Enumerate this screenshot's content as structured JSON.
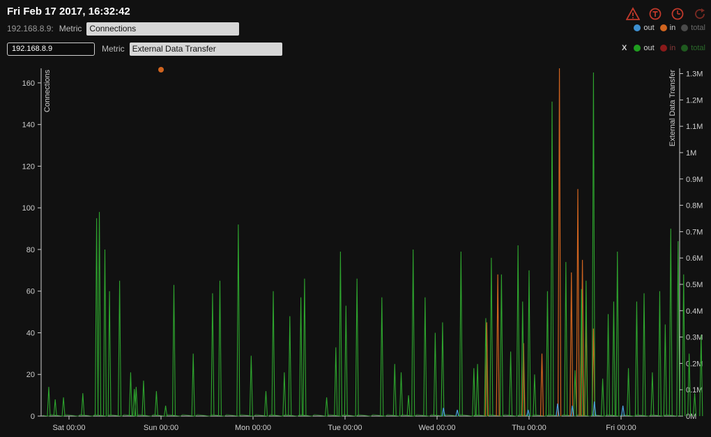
{
  "header": {
    "timestamp": "Fri Feb 17 2017, 16:32:42",
    "toolbar_icons": [
      "warning-icon",
      "cube-refresh-icon",
      "clock-icon",
      "reload-icon"
    ]
  },
  "metric1": {
    "ip_label": "192.168.8.9:",
    "metric_label": "Metric",
    "selected": "Connections"
  },
  "metric2": {
    "ip_value": "192.168.8.9",
    "metric_label": "Metric",
    "selected": "External Data Transfer"
  },
  "legend1": {
    "items": [
      {
        "label": "out",
        "color": "#3d8fd1"
      },
      {
        "label": "in",
        "color": "#d0641f"
      },
      {
        "label": "total",
        "color": "#4a4a4a"
      }
    ]
  },
  "legend2": {
    "close": "X",
    "items": [
      {
        "label": "out",
        "color": "#1f9e1f"
      },
      {
        "label": "in",
        "color": "#8a1a1a"
      },
      {
        "label": "total",
        "color": "#1f5a1f"
      }
    ]
  },
  "colors": {
    "background": "#111111",
    "out_green": "#2ea52e",
    "in_orange": "#d0641f",
    "conn_blue": "#4aa3e0"
  },
  "chart_data": {
    "type": "line",
    "ylabel": "Connections",
    "y2label": "External Data Transfer",
    "yticks": [
      0,
      20,
      40,
      60,
      80,
      100,
      120,
      140,
      160
    ],
    "y2ticks": [
      "0M",
      "0.1M",
      "0.2M",
      "0.3M",
      "0.4M",
      "0.5M",
      "0.6M",
      "0.7M",
      "0.8M",
      "0.9M",
      "1M",
      "1.1M",
      "1.2M",
      "1.3M"
    ],
    "xticks": [
      "Sat 00:00",
      "Sun 00:00",
      "Mon 00:00",
      "Tue 00:00",
      "Wed 00:00",
      "Thu 00:00",
      "Fri 00:00"
    ],
    "ylim": [
      0,
      167
    ],
    "y2lim": [
      0,
      1.32
    ],
    "marker": {
      "day": 1.0,
      "value": 167
    },
    "spikes_out": [
      [
        -0.22,
        14
      ],
      [
        -0.15,
        8
      ],
      [
        -0.06,
        9
      ],
      [
        0.15,
        11
      ],
      [
        0.3,
        95
      ],
      [
        0.33,
        98
      ],
      [
        0.39,
        80
      ],
      [
        0.44,
        60
      ],
      [
        0.55,
        65
      ],
      [
        0.67,
        21
      ],
      [
        0.71,
        13
      ],
      [
        0.73,
        14
      ],
      [
        0.81,
        17
      ],
      [
        0.95,
        12
      ],
      [
        1.05,
        5
      ],
      [
        1.14,
        63
      ],
      [
        1.35,
        30
      ],
      [
        1.56,
        59
      ],
      [
        1.64,
        65
      ],
      [
        1.84,
        92
      ],
      [
        1.98,
        29
      ],
      [
        2.14,
        12
      ],
      [
        2.22,
        60
      ],
      [
        2.34,
        21
      ],
      [
        2.4,
        48
      ],
      [
        2.52,
        57
      ],
      [
        2.56,
        66
      ],
      [
        2.8,
        9
      ],
      [
        2.9,
        33
      ],
      [
        2.95,
        79
      ],
      [
        3.01,
        53
      ],
      [
        3.13,
        66
      ],
      [
        3.4,
        57
      ],
      [
        3.54,
        25
      ],
      [
        3.61,
        21
      ],
      [
        3.69,
        10
      ],
      [
        3.74,
        80
      ],
      [
        3.87,
        57
      ],
      [
        3.98,
        40
      ],
      [
        4.06,
        45
      ],
      [
        4.26,
        79
      ],
      [
        4.4,
        23
      ],
      [
        4.44,
        25
      ],
      [
        4.53,
        47
      ],
      [
        4.59,
        76
      ],
      [
        4.7,
        68
      ],
      [
        4.8,
        31
      ],
      [
        4.88,
        82
      ],
      [
        4.93,
        55
      ],
      [
        5.0,
        70
      ],
      [
        5.06,
        20
      ],
      [
        5.2,
        60
      ],
      [
        5.25,
        151
      ],
      [
        5.4,
        74
      ],
      [
        5.5,
        22
      ],
      [
        5.57,
        61
      ],
      [
        5.62,
        65
      ],
      [
        5.7,
        165
      ],
      [
        5.8,
        18
      ],
      [
        5.86,
        49
      ],
      [
        5.92,
        55
      ],
      [
        5.96,
        79
      ],
      [
        6.08,
        23
      ],
      [
        6.17,
        55
      ],
      [
        6.25,
        59
      ],
      [
        6.34,
        21
      ],
      [
        6.42,
        60
      ],
      [
        6.48,
        44
      ],
      [
        6.54,
        90
      ],
      [
        6.62,
        84
      ],
      [
        6.68,
        68
      ],
      [
        6.74,
        30
      ],
      [
        6.8,
        11
      ],
      [
        6.87,
        39
      ]
    ],
    "spikes_in": [
      [
        4.54,
        45
      ],
      [
        4.66,
        68
      ],
      [
        4.94,
        35
      ],
      [
        5.14,
        30
      ],
      [
        5.33,
        167
      ],
      [
        5.46,
        69
      ],
      [
        5.53,
        109
      ],
      [
        5.58,
        75
      ],
      [
        5.62,
        48
      ],
      [
        5.7,
        42
      ]
    ],
    "spikes_conn": [
      [
        4.07,
        4
      ],
      [
        4.22,
        3
      ],
      [
        4.99,
        3
      ],
      [
        5.31,
        6
      ],
      [
        5.47,
        5
      ],
      [
        5.71,
        7
      ],
      [
        6.02,
        5
      ]
    ]
  }
}
